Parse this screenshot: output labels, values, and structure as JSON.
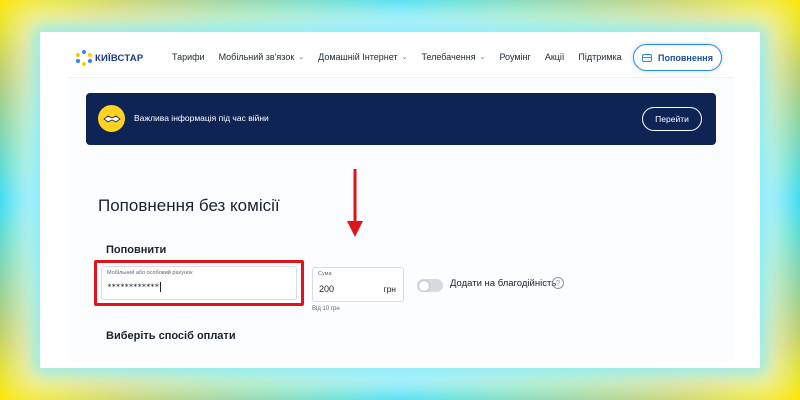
{
  "header": {
    "logo_text": "КИЇВСТАР",
    "nav": [
      {
        "label": "Тарифи",
        "has_dropdown": false
      },
      {
        "label": "Мобільний зв'язок",
        "has_dropdown": true
      },
      {
        "label": "Домашній Інтернет",
        "has_dropdown": true
      },
      {
        "label": "Телебачення",
        "has_dropdown": true
      },
      {
        "label": "Роумінг",
        "has_dropdown": false
      },
      {
        "label": "Акції",
        "has_dropdown": false
      },
      {
        "label": "Підтримка",
        "has_dropdown": false
      }
    ],
    "topup_button": "Поповнення",
    "chevron": "⌄"
  },
  "banner": {
    "text": "Важлива інформація під час війни",
    "button": "Перейти",
    "icon": "handshake-icon"
  },
  "main": {
    "title": "Поповнення без комісії",
    "topup_section": "Поповнити",
    "account_field": {
      "label": "Мобільний або особовий рахунок",
      "value": "************"
    },
    "sum_field": {
      "label": "Сума",
      "value": "200",
      "unit": "грн",
      "hint": "Від 10 грн"
    },
    "charity_toggle": {
      "label": "Додати на благодійність",
      "on": false
    },
    "help_icon": "?",
    "payment_section": "Виберіть спосіб оплати"
  },
  "colors": {
    "accent": "#2a8be0",
    "banner": "#0d2454",
    "highlight": "#e0141c",
    "badge": "#ffd21f"
  }
}
